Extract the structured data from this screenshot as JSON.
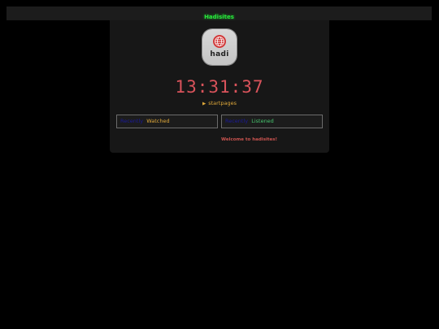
{
  "header": {
    "title": "Hadisites",
    "title_color": "#27e23a"
  },
  "logo": {
    "text": "hadi",
    "icon": "globe-icon"
  },
  "clock": {
    "time": "13:31:37",
    "color": "#d9535b"
  },
  "startpages": {
    "toggle_icon": "triangle-right-icon",
    "label": "startpages"
  },
  "stats": {
    "watched": {
      "label": "Recently",
      "value": "Watched"
    },
    "listened": {
      "label": "Recently",
      "value": "Listened"
    }
  },
  "welcome": {
    "text": "Welcome to hadisites!"
  }
}
